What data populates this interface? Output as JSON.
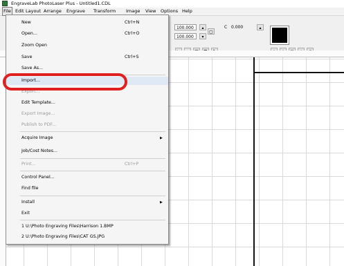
{
  "window": {
    "title": "EngraveLab PhotoLaser Plus - Untitled1.CDL"
  },
  "menubar": {
    "items": [
      "File",
      "Edit",
      "Layout",
      "Arrange",
      "Engrave",
      "Transform",
      "Image",
      "View",
      "Options",
      "Help"
    ]
  },
  "toolbar": {
    "width_value": "100.000",
    "height_value": "100.000",
    "rotation_value": "0.000",
    "rotation_symbol": "C"
  },
  "file_menu": {
    "items": [
      {
        "label": "New",
        "shortcut": "Ctrl+N",
        "enabled": true
      },
      {
        "label": "Open...",
        "shortcut": "Ctrl+O",
        "enabled": true
      },
      {
        "label": "Zoom Open",
        "shortcut": "",
        "enabled": true
      },
      {
        "label": "Save",
        "shortcut": "Ctrl+S",
        "enabled": true
      },
      {
        "label": "Save As...",
        "shortcut": "",
        "enabled": true
      },
      {
        "label": "Import...",
        "shortcut": "",
        "enabled": true
      },
      {
        "label": "Export...",
        "shortcut": "",
        "enabled": false
      },
      {
        "label": "Edit Template...",
        "shortcut": "",
        "enabled": true
      },
      {
        "label": "Export Image...",
        "shortcut": "",
        "enabled": false
      },
      {
        "label": "Publish to PDF...",
        "shortcut": "",
        "enabled": false
      },
      {
        "label": "Acquire Image",
        "shortcut": "",
        "enabled": true
      },
      {
        "label": "Job/Cost Notes...",
        "shortcut": "",
        "enabled": true
      },
      {
        "label": "Print...",
        "shortcut": "Ctrl+P",
        "enabled": false
      },
      {
        "label": "Control Panel...",
        "shortcut": "",
        "enabled": true
      },
      {
        "label": "Find file",
        "shortcut": "",
        "enabled": true
      },
      {
        "label": "Install",
        "shortcut": "",
        "enabled": true
      },
      {
        "label": "Exit",
        "shortcut": "",
        "enabled": true
      },
      {
        "label": "1 U:\\Photo Engraving Files\\Harrison 1.BMP",
        "shortcut": "",
        "enabled": true
      },
      {
        "label": "2 U:\\Photo Engraving Files\\CAT GS.JPG",
        "shortcut": "",
        "enabled": true
      }
    ],
    "submenu_arrow": "▶"
  },
  "colors": {
    "callout": "#e02020",
    "selection_swatch": "#000000"
  }
}
